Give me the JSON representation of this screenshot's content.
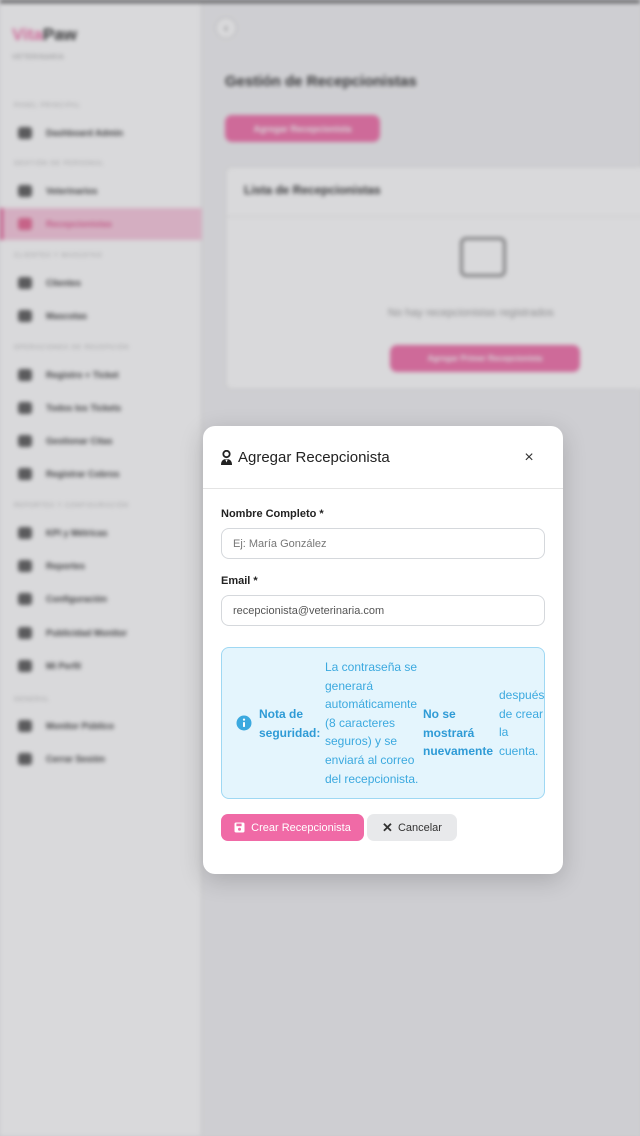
{
  "sidebar": {
    "brand_part1": "Vita",
    "brand_part2": "Paw",
    "brand_sub": "VETERINARIA",
    "sections": {
      "panel": "PANEL PRINCIPAL",
      "personal": "GESTIÓN DE PERSONAL",
      "clientes": "CLIENTES Y MASCOTAS",
      "operaciones": "OPERACIONES DE RECEPCIÓN",
      "reportes": "REPORTES Y CONFIGURACIÓN",
      "general": "GENERAL"
    },
    "items": {
      "dashboard": "Dashboard Admin",
      "veterinarios": "Veterinarios",
      "recepcionistas": "Recepcionistas",
      "clientes": "Clientes",
      "mascotas": "Mascotas",
      "registro": "Registro + Ticket",
      "tickets": "Todos los Tickets",
      "citas": "Gestionar Citas",
      "cobros": "Registrar Cobros",
      "kpi": "KPI y Métricas",
      "reportes": "Reportes",
      "configuracion": "Configuración",
      "publicidad": "Publicidad Monitor",
      "perfil": "Mi Perfil",
      "monitor": "Monitor Público",
      "logout": "Cerrar Sesión"
    }
  },
  "main": {
    "page_title": "Gestión de Recepcionistas",
    "add_button": "Agregar Recepcionista",
    "list_title": "Lista de Recepcionistas",
    "empty_text": "No hay recepcionistas registrados",
    "first_button": "Agregar Primer Recepcionista"
  },
  "modal": {
    "title": "Agregar Recepcionista",
    "close": "×",
    "name_label": "Nombre Completo *",
    "name_placeholder": "Ej: María González",
    "email_label": "Email *",
    "email_value": "recepcionista@veterinaria.com",
    "note": {
      "label": "Nota de seguridad:",
      "text1": "La contraseña se generará automáticamente (8 caracteres seguros) y se enviará al correo del recepcionista.",
      "bold": "No se mostrará nuevamente",
      "text2": "después de crear la cuenta."
    },
    "create_button": "Crear Recepcionista",
    "cancel_button": "Cancelar"
  },
  "colors": {
    "accent": "#f06aa6",
    "info_bg": "#e4f5fd",
    "info_text": "#3ba9df"
  }
}
